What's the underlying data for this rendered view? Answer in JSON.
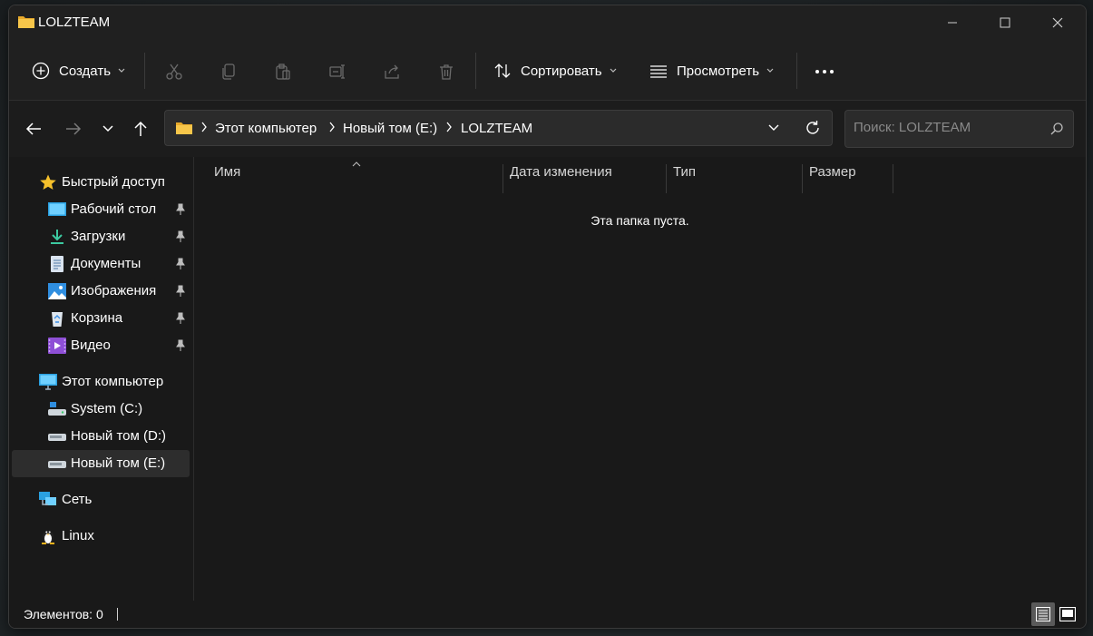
{
  "window": {
    "title": "LOLZTEAM",
    "controls": [
      "minimize-icon",
      "maximize-icon",
      "close-icon"
    ]
  },
  "toolbar": {
    "create_label": "Создать",
    "sort_label": "Сортировать",
    "view_label": "Просмотреть",
    "icons": [
      "cut-icon",
      "copy-icon",
      "paste-icon",
      "rename-icon",
      "share-icon",
      "delete-icon",
      "more-icon"
    ]
  },
  "navigation": {
    "address_parts": [
      "Этот компьютер",
      "Новый том (E:)",
      "LOLZTEAM"
    ],
    "search_placeholder": "Поиск: LOLZTEAM"
  },
  "sidebar": {
    "quick_access": {
      "label": "Быстрый доступ",
      "items": [
        {
          "label": "Рабочий стол",
          "icon": "desktop-icon",
          "pinned": true
        },
        {
          "label": "Загрузки",
          "icon": "downloads-icon",
          "pinned": true
        },
        {
          "label": "Документы",
          "icon": "documents-icon",
          "pinned": true
        },
        {
          "label": "Изображения",
          "icon": "pictures-icon",
          "pinned": true
        },
        {
          "label": "Корзина",
          "icon": "recycle-bin-icon",
          "pinned": true
        },
        {
          "label": "Видео",
          "icon": "videos-icon",
          "pinned": true
        }
      ]
    },
    "this_pc": {
      "label": "Этот компьютер",
      "drives": [
        {
          "label": "System (C:)",
          "icon": "system-drive-icon"
        },
        {
          "label": "Новый том (D:)",
          "icon": "drive-icon"
        },
        {
          "label": "Новый том (E:)",
          "icon": "drive-icon",
          "selected": true
        }
      ]
    },
    "network": {
      "label": "Сеть"
    },
    "linux": {
      "label": "Linux"
    }
  },
  "columns": [
    "Имя",
    "Дата изменения",
    "Тип",
    "Размер"
  ],
  "empty_message": "Эта папка пуста.",
  "status": {
    "items_label": "Элементов: 0"
  },
  "colors": {
    "background": "#191919",
    "toolbar": "#202020",
    "folder": "#f7c64a",
    "text": "#ffffff",
    "selection": "#2d2d2d"
  }
}
